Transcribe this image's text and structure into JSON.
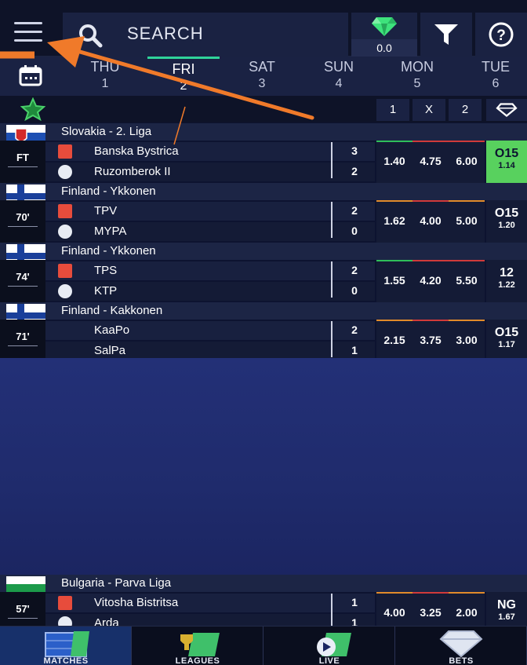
{
  "header": {
    "search_label": "SEARCH",
    "gem_value": "0.0"
  },
  "dates": [
    {
      "day": "THU",
      "num": "1",
      "active": false
    },
    {
      "day": "FRI",
      "num": "2",
      "active": true
    },
    {
      "day": "SAT",
      "num": "3",
      "active": false
    },
    {
      "day": "SUN",
      "num": "4",
      "active": false
    },
    {
      "day": "MON",
      "num": "5",
      "active": false
    },
    {
      "day": "TUE",
      "num": "6",
      "active": false
    }
  ],
  "columns": {
    "one": "1",
    "x": "X",
    "two": "2"
  },
  "matches": [
    {
      "league": "Slovakia - 2. Liga",
      "flag": "slovakia",
      "status": "FT",
      "home": "Banska Bystrica",
      "home_score": "3",
      "away": "Ruzomberok II",
      "away_score": "2",
      "odds": [
        "1.40",
        "4.75",
        "6.00"
      ],
      "pred_main": "O15",
      "pred_sub": "1.14",
      "pred_highlight": true
    },
    {
      "league": "Finland - Ykkonen",
      "flag": "finland",
      "status": "70'",
      "home": "TPV",
      "home_score": "2",
      "away": "MYPA",
      "away_score": "0",
      "odds": [
        "1.62",
        "4.00",
        "5.00"
      ],
      "pred_main": "O15",
      "pred_sub": "1.20",
      "pred_highlight": false
    },
    {
      "league": "Finland - Ykkonen",
      "flag": "finland",
      "status": "74'",
      "home": "TPS",
      "home_score": "2",
      "away": "KTP",
      "away_score": "0",
      "odds": [
        "1.55",
        "4.20",
        "5.50"
      ],
      "pred_main": "12",
      "pred_sub": "1.22",
      "pred_highlight": false
    },
    {
      "league": "Finland - Kakkonen",
      "flag": "finland",
      "status": "71'",
      "home": "KaaPo",
      "home_score": "2",
      "away": "SalPa",
      "away_score": "1",
      "odds": [
        "2.15",
        "3.75",
        "3.00"
      ],
      "pred_main": "O15",
      "pred_sub": "1.17",
      "pred_highlight": false
    },
    {
      "league": "Bulgaria - Parva Liga",
      "flag": "bulgaria",
      "status": "57'",
      "home": "Vitosha Bistritsa",
      "home_score": "1",
      "away": "Arda",
      "away_score": "1",
      "odds": [
        "4.00",
        "3.25",
        "2.00"
      ],
      "pred_main": "NG",
      "pred_sub": "1.67",
      "pred_highlight": false
    }
  ],
  "nav": [
    {
      "label": "MATCHES",
      "icon": "matches-icon",
      "active": true
    },
    {
      "label": "LEAGUES",
      "icon": "leagues-icon",
      "active": false
    },
    {
      "label": "LIVE",
      "icon": "live-icon",
      "active": false
    },
    {
      "label": "BETS",
      "icon": "bets-icon",
      "active": false
    }
  ],
  "colors": {
    "accent_green": "#2fd39a",
    "highlight_green": "#58d15e",
    "arrow_orange": "#f07a2a"
  }
}
